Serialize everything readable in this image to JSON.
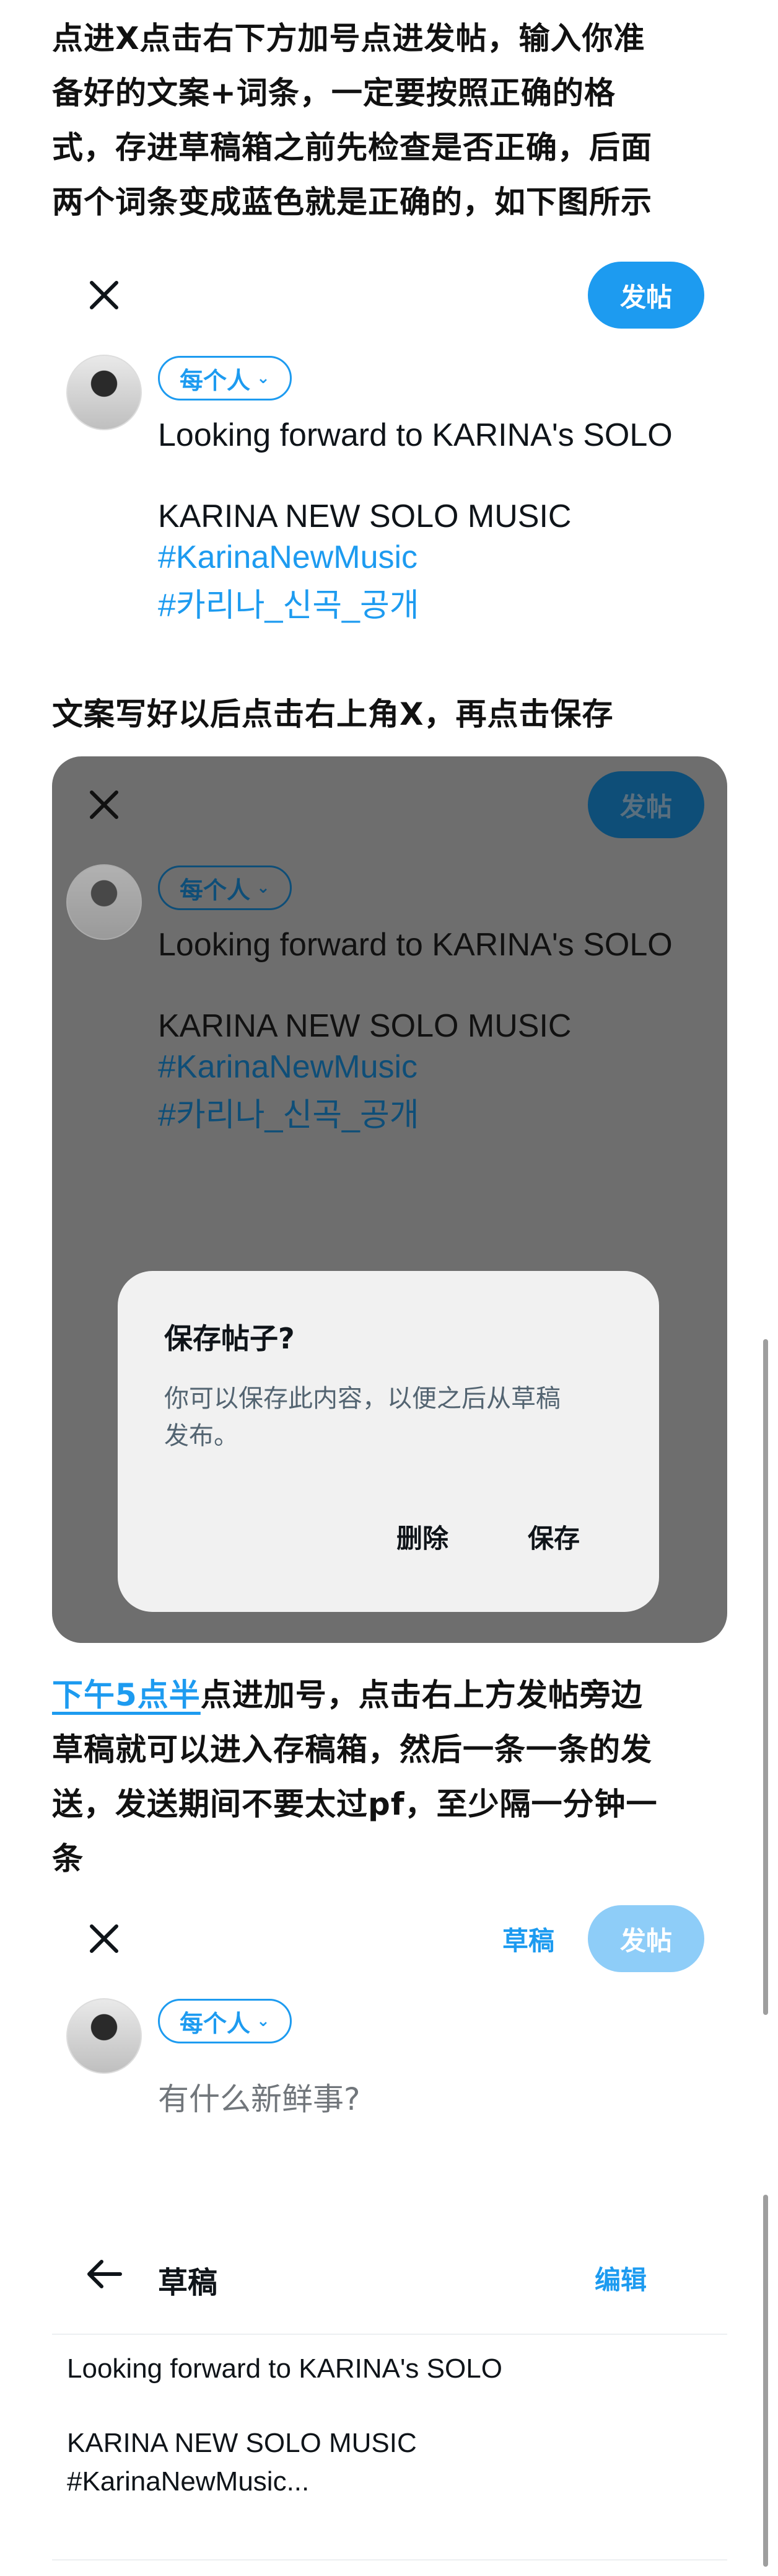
{
  "colors": {
    "accent": "#1d9bf0",
    "overlay": "#6e6e6e",
    "dialog": "#f1f1f1"
  },
  "paragraphs": {
    "p1": [
      "点进X点击右下方加号点进发帖，输入你准",
      "备好的文案+词条，一定要按照正确的格",
      "式，存进草稿箱之前先检查是否正确，后面",
      "两个词条变成蓝色就是正确的，如下图所示"
    ],
    "p2": "文案写好以后点击右上角X，再点击保存",
    "p3_link": "下午5点半",
    "p3": [
      "点进加号，点击右上方发帖旁边",
      "草稿就可以进入存稿箱，然后一条一条的发",
      "送，发送期间不要太过pf，至少隔一分钟一",
      "条"
    ]
  },
  "composer": {
    "post_label": "发帖",
    "audience_label": "每个人",
    "line1": "Looking forward to KARINA's SOLO",
    "line2": "KARINA NEW SOLO MUSIC",
    "hashtag1": "#KarinaNewMusic",
    "hashtag2": "#카리나_신곡_공개"
  },
  "dialog": {
    "title": "保存帖子?",
    "body_line1": "你可以保存此内容，以便之后从草稿",
    "body_line2": "发布。",
    "delete_label": "删除",
    "save_label": "保存"
  },
  "composer_empty": {
    "drafts_label": "草稿",
    "post_label": "发帖",
    "audience_label": "每个人",
    "placeholder": "有什么新鲜事?"
  },
  "drafts": {
    "title": "草稿",
    "edit_label": "编辑",
    "item_line1": "Looking forward to KARINA's SOLO",
    "item_line2": "KARINA NEW SOLO MUSIC",
    "item_line3": "#KarinaNewMusic..."
  },
  "icons": [
    "close-icon",
    "chevron-down-icon",
    "back-arrow-icon"
  ]
}
